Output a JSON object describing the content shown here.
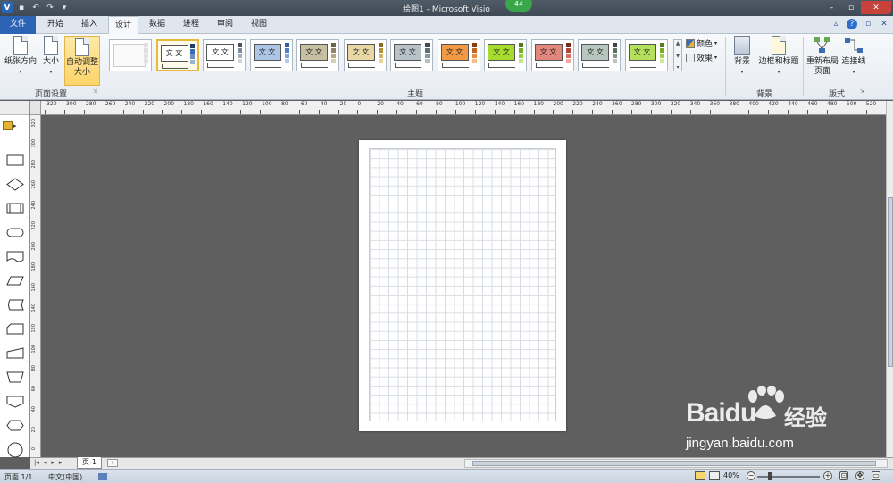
{
  "title_bar": {
    "title": "绘图1 - Microsoft Visio",
    "badge": "44"
  },
  "tabs": [
    "文件",
    "开始",
    "插入",
    "设计",
    "数据",
    "进程",
    "审阅",
    "视图"
  ],
  "active_tab": "设计",
  "ribbon": {
    "page_setup": {
      "orientation_label": "纸张方向",
      "size_label": "大小",
      "autosize_label_1": "自动调整",
      "autosize_label_2": "大小",
      "group_label": "页面设置"
    },
    "themes": {
      "group_label": "主题",
      "sample_text": "文 文",
      "items": [
        {
          "fill": "#ffffff",
          "swatches": []
        },
        {
          "fill": "#ffffff",
          "swatches": [
            "#1f3a6b",
            "#3b6bb5",
            "#6e8fc6",
            "#9db4d9"
          ]
        },
        {
          "fill": "#ffffff",
          "swatches": [
            "#44546a",
            "#7b8a9a",
            "#a5b1bd",
            "#cfd6dd"
          ]
        },
        {
          "fill": "#aec6e6",
          "swatches": [
            "#2e5fa6",
            "#4c7ec9",
            "#7fa3da",
            "#b4cbeb"
          ]
        },
        {
          "fill": "#c7c0a3",
          "swatches": [
            "#6b6243",
            "#8f8562",
            "#b3a97f",
            "#d6cfb2"
          ]
        },
        {
          "fill": "#e8d8a6",
          "swatches": [
            "#8a6a1e",
            "#b58f33",
            "#d4b15e",
            "#ead596"
          ]
        },
        {
          "fill": "#b8c3c9",
          "swatches": [
            "#3c4e58",
            "#5d717c",
            "#8798a1",
            "#b5c1c7"
          ]
        },
        {
          "fill": "#f29a45",
          "swatches": [
            "#8a3f0b",
            "#c8621c",
            "#eb8d3f",
            "#f6bf8a"
          ]
        },
        {
          "fill": "#a6dc2d",
          "swatches": [
            "#4c7d12",
            "#6fae1c",
            "#94d03a",
            "#c4e889"
          ]
        },
        {
          "fill": "#e3877c",
          "swatches": [
            "#7d2a22",
            "#b2453a",
            "#d86f63",
            "#eeaaa2"
          ]
        },
        {
          "fill": "#b7c6bf",
          "swatches": [
            "#34493f",
            "#597065",
            "#86998f",
            "#b8c6bf"
          ]
        },
        {
          "fill": "#b5e05c",
          "swatches": [
            "#4f7e14",
            "#77ac20",
            "#9fcf46",
            "#cde99a"
          ]
        }
      ],
      "colors_label": "颜色",
      "effects_label": "效果"
    },
    "background": {
      "background_label": "背景",
      "borders_label": "边框和标题",
      "group_label": "背景"
    },
    "layout": {
      "relayout_label_1": "重新布局",
      "relayout_label_2": "页面",
      "connector_label": "连接线",
      "group_label": "版式"
    }
  },
  "ruler_h_labels": [
    "-320",
    "-300",
    "-280",
    "-260",
    "-240",
    "-220",
    "-200",
    "-180",
    "-160",
    "-140",
    "-120",
    "-100",
    "-80",
    "-60",
    "-40",
    "-20",
    "0",
    "20",
    "40",
    "60",
    "80",
    "100",
    "120",
    "140",
    "160",
    "180",
    "200",
    "220",
    "240",
    "260",
    "280",
    "300",
    "320",
    "340",
    "360",
    "380",
    "400",
    "420",
    "440",
    "460",
    "480",
    "500",
    "520"
  ],
  "ruler_v_labels": [
    "320",
    "300",
    "280",
    "260",
    "240",
    "220",
    "200",
    "180",
    "160",
    "140",
    "120",
    "100",
    "80",
    "60",
    "40",
    "20",
    "0"
  ],
  "stencil_shapes": [
    "rectangle",
    "diamond",
    "process",
    "terminator",
    "document",
    "data",
    "stored-data",
    "card",
    "manual-input",
    "manual-operation",
    "off-page",
    "preparation",
    "connector"
  ],
  "page_tab": "页-1",
  "status": {
    "page": "页面 1/1",
    "language": "中文(中国)",
    "zoom": "40%"
  },
  "watermark": {
    "brand": "Baidu",
    "cn": "经验",
    "url": "jingyan.baidu.com"
  }
}
